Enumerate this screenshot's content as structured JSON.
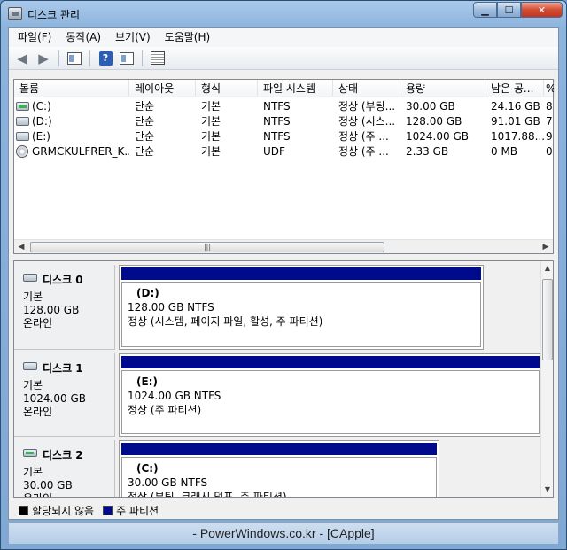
{
  "window": {
    "title": "디스크 관리"
  },
  "menu": [
    "파일(F)",
    "동작(A)",
    "보기(V)",
    "도움말(H)"
  ],
  "toolbar": {
    "back_icon": "back-arrow-icon",
    "forward_icon": "forward-arrow-icon",
    "help_glyph": "?"
  },
  "volume_list": {
    "columns": [
      "볼륨",
      "레이아웃",
      "형식",
      "파일 시스템",
      "상태",
      "용량",
      "남은 공...",
      "%"
    ],
    "rows": [
      {
        "icon": "disk-green",
        "volume": "(C:)",
        "layout": "단순",
        "type": "기본",
        "fs": "NTFS",
        "status": "정상 (부팅...",
        "capacity": "30.00 GB",
        "free": "24.16 GB",
        "pct": "8"
      },
      {
        "icon": "disk",
        "volume": "(D:)",
        "layout": "단순",
        "type": "기본",
        "fs": "NTFS",
        "status": "정상 (시스...",
        "capacity": "128.00 GB",
        "free": "91.01 GB",
        "pct": "7"
      },
      {
        "icon": "disk",
        "volume": "(E:)",
        "layout": "단순",
        "type": "기본",
        "fs": "NTFS",
        "status": "정상 (주 ...",
        "capacity": "1024.00 GB",
        "free": "1017.88...",
        "pct": "9"
      },
      {
        "icon": "cdrom",
        "volume": "GRMCKULFRER_K...",
        "layout": "단순",
        "type": "기본",
        "fs": "UDF",
        "status": "정상 (주 ...",
        "capacity": "2.33 GB",
        "free": "0 MB",
        "pct": "0"
      }
    ]
  },
  "disks": [
    {
      "name": "디스크 0",
      "kind": "기본",
      "size": "128.00 GB",
      "state": "온라인",
      "partition": {
        "label": "(D:)",
        "info": "128.00 GB NTFS",
        "status": "정상 (시스템, 페이지 파일, 활성, 주 파티션)"
      }
    },
    {
      "name": "디스크 1",
      "kind": "기본",
      "size": "1024.00 GB",
      "state": "온라인",
      "partition": {
        "label": "(E:)",
        "info": "1024.00 GB NTFS",
        "status": "정상 (주 파티션)"
      }
    },
    {
      "name": "디스크 2",
      "kind": "기본",
      "size": "30.00 GB",
      "state": "온라인",
      "partition": {
        "label": "(C:)",
        "info": "30.00 GB NTFS",
        "status": "정상 (부팅, 크래시 덤프, 주 파티션)"
      }
    }
  ],
  "legend": [
    {
      "label": "할당되지 않음",
      "color": "#000000"
    },
    {
      "label": "주 파티션",
      "color": "#000a8c"
    }
  ],
  "statusbar": {
    "text": "- PowerWindows.co.kr - [CApple]"
  }
}
